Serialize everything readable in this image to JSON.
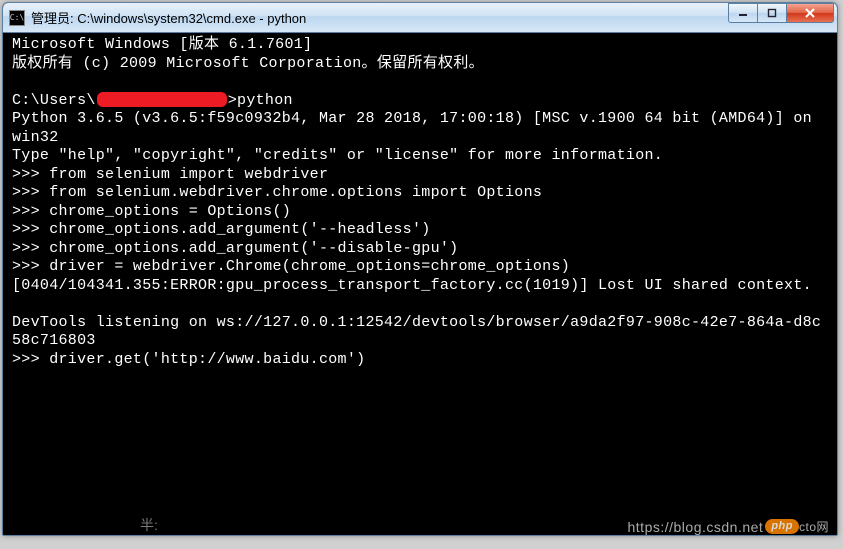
{
  "window": {
    "title": "管理员: C:\\windows\\system32\\cmd.exe - python",
    "icon_glyph": "C:\\"
  },
  "terminal": {
    "lines": [
      "Microsoft Windows [版本 6.1.7601]",
      "版权所有 (c) 2009 Microsoft Corporation。保留所有权利。",
      "",
      {
        "pre": "C:\\Users\\",
        "redacted": true,
        "post": ">python"
      },
      "Python 3.6.5 (v3.6.5:f59c0932b4, Mar 28 2018, 17:00:18) [MSC v.1900 64 bit (AMD64)] on win32",
      "Type \"help\", \"copyright\", \"credits\" or \"license\" for more information.",
      ">>> from selenium import webdriver",
      ">>> from selenium.webdriver.chrome.options import Options",
      ">>> chrome_options = Options()",
      ">>> chrome_options.add_argument('--headless')",
      ">>> chrome_options.add_argument('--disable-gpu')",
      ">>> driver = webdriver.Chrome(chrome_options=chrome_options)",
      "[0404/104341.355:ERROR:gpu_process_transport_factory.cc(1019)] Lost UI shared context.",
      "",
      "DevTools listening on ws://127.0.0.1:12542/devtools/browser/a9da2f97-908c-42e7-864a-d8c58c716803",
      ">>> driver.get('http://www.baidu.com')"
    ]
  },
  "footer_label": "半:",
  "watermark": {
    "text_left": "https://blog.csdn.net",
    "badge": "php",
    "text_right": "cto网"
  }
}
